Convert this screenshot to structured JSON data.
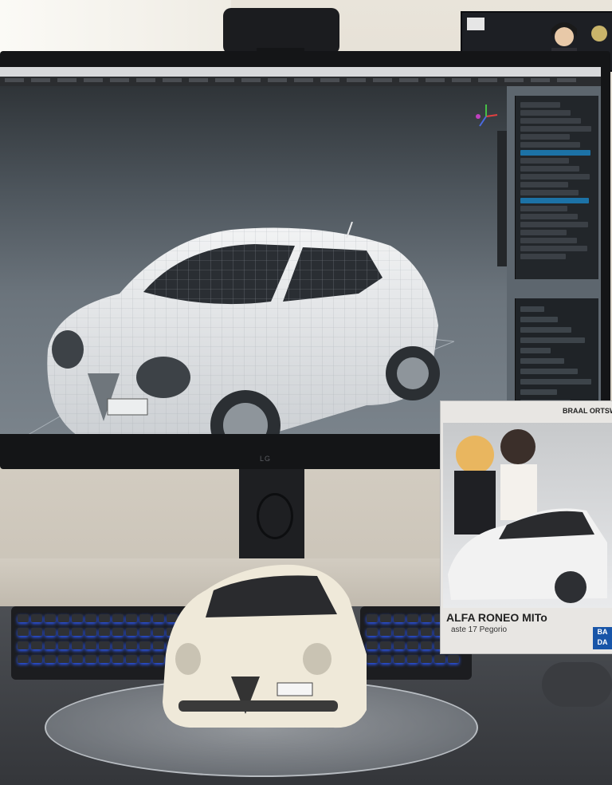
{
  "scene": {
    "description_kind": "photo",
    "colors": {
      "wall": "#e2ddd2",
      "monitor_bezel": "#141517",
      "viewport_sky": "#2f3438",
      "viewport_floor": "#7a838b",
      "selection_blue": "#1c72a6",
      "keyboard_backlight": "#2d5bff",
      "model_car_body": "#efe9d9",
      "box_brand": "#1855a8"
    }
  },
  "monitor": {
    "brand_logo": "LG"
  },
  "box": {
    "header": "BRAAL ORTSW",
    "title": "ALFA RONEO MITo",
    "subtitle": "aste 17 Pegorio",
    "brand_lines": [
      "BA",
      "DA"
    ]
  },
  "icons": {
    "gizmo": "axis-gizmo-icon",
    "taskbar": "taskbar-app-icon"
  }
}
